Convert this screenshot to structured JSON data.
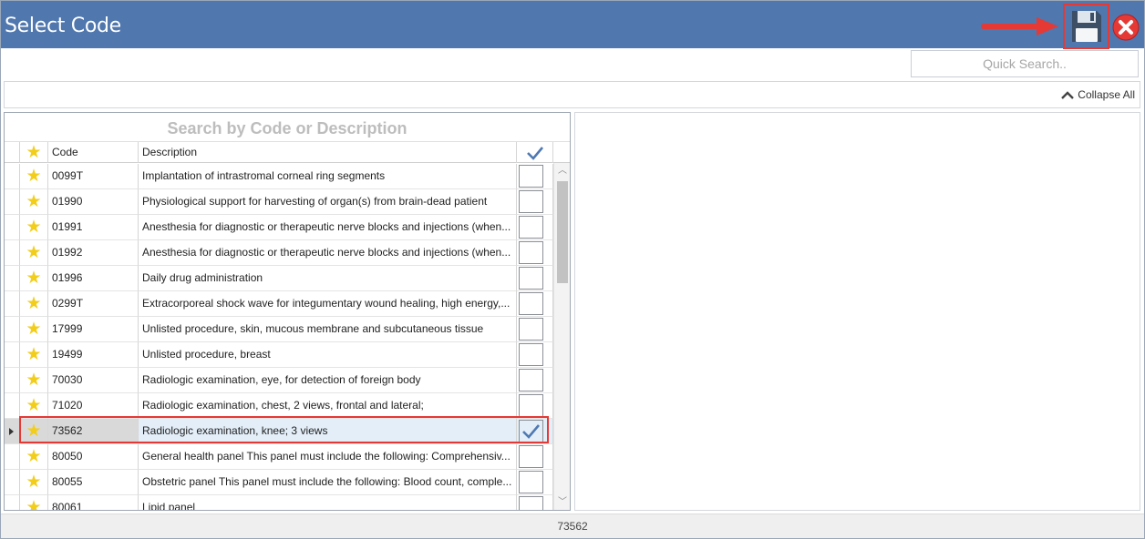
{
  "window": {
    "title": "Select Code"
  },
  "toolbar": {
    "save_icon": "floppy-disk-icon",
    "close_icon": "close-circle-icon",
    "accent": "#5077ae",
    "highlight": "#e53935"
  },
  "search": {
    "placeholder": "Quick Search.."
  },
  "collapse": {
    "label": "Collapse All"
  },
  "grid": {
    "search_label": "Search by Code or Description",
    "columns": {
      "code": "Code",
      "description": "Description"
    },
    "rows": [
      {
        "code": "0099T",
        "description": "Implantation of intrastromal corneal ring segments",
        "checked": false
      },
      {
        "code": "01990",
        "description": "Physiological support for harvesting of organ(s) from brain-dead patient",
        "checked": false
      },
      {
        "code": "01991",
        "description": "Anesthesia for diagnostic or therapeutic nerve blocks and injections (when...",
        "checked": false
      },
      {
        "code": "01992",
        "description": "Anesthesia for diagnostic or therapeutic nerve blocks and injections (when...",
        "checked": false
      },
      {
        "code": "01996",
        "description": "Daily drug administration",
        "checked": false
      },
      {
        "code": "0299T",
        "description": "Extracorporeal shock wave for integumentary wound healing, high energy,...",
        "checked": false
      },
      {
        "code": "17999",
        "description": "Unlisted procedure, skin, mucous membrane and subcutaneous tissue",
        "checked": false
      },
      {
        "code": "19499",
        "description": "Unlisted procedure, breast",
        "checked": false
      },
      {
        "code": "70030",
        "description": "Radiologic examination, eye, for detection of foreign body",
        "checked": false
      },
      {
        "code": "71020",
        "description": "Radiologic examination, chest, 2 views, frontal and lateral;",
        "checked": false
      },
      {
        "code": "73562",
        "description": "Radiologic examination, knee; 3 views",
        "checked": true,
        "selected": true
      },
      {
        "code": "80050",
        "description": "General health panel This panel must include the following: Comprehensiv...",
        "checked": false
      },
      {
        "code": "80055",
        "description": "Obstetric panel This panel must include the following: Blood count, comple...",
        "checked": false
      },
      {
        "code": "80061",
        "description": "Lipid panel",
        "checked": false
      }
    ]
  },
  "status": {
    "text": "73562"
  }
}
